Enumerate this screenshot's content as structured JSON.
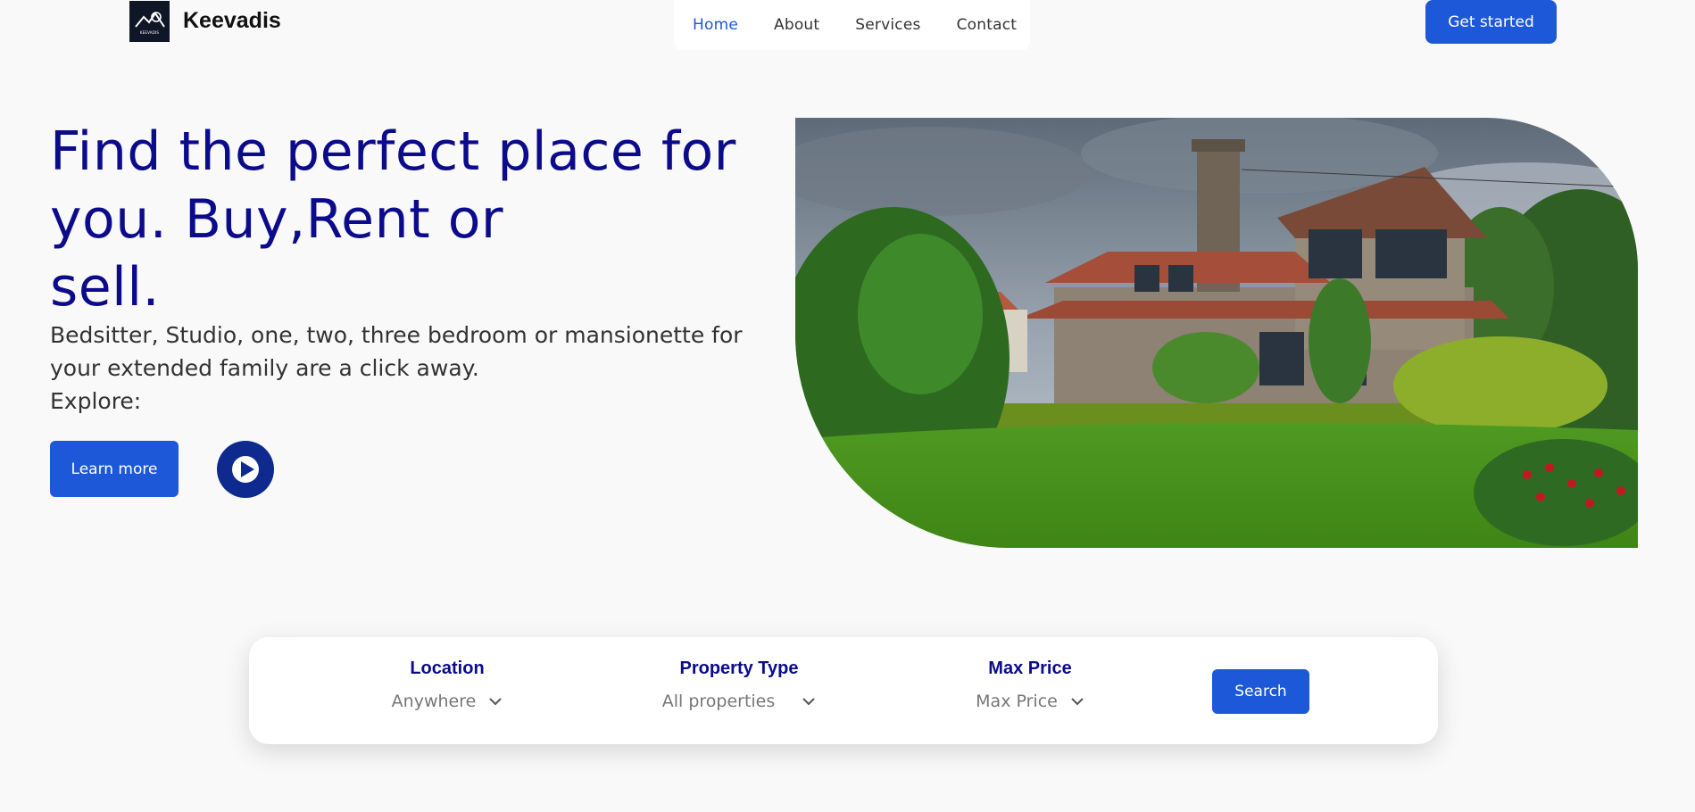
{
  "header": {
    "brand": "Keevadis",
    "logo_text": "KEEVADIS",
    "nav": [
      {
        "label": "Home",
        "active": true
      },
      {
        "label": "About",
        "active": false
      },
      {
        "label": "Services",
        "active": false
      },
      {
        "label": "Contact",
        "active": false
      }
    ],
    "cta_label": "Get started"
  },
  "hero": {
    "title_lines": [
      "Find the perfect place for",
      "you. Buy,Rent or",
      "sell."
    ],
    "subtitle_lines": [
      "Bedsitter, Studio, one, two, three bedroom or mansionette for",
      "your extended family are a click away.",
      "Explore:"
    ],
    "learn_more_label": "Learn more",
    "play_icon": "play-icon"
  },
  "search": {
    "location": {
      "label": "Location",
      "value": "Anywhere"
    },
    "property_type": {
      "label": "Property Type",
      "value": "All properties"
    },
    "max_price": {
      "label": "Max Price",
      "value": "Max Price"
    },
    "submit_label": "Search"
  },
  "colors": {
    "accent": "#1d58d8",
    "heading": "#0b0b8c",
    "background": "#f9f9f9"
  }
}
